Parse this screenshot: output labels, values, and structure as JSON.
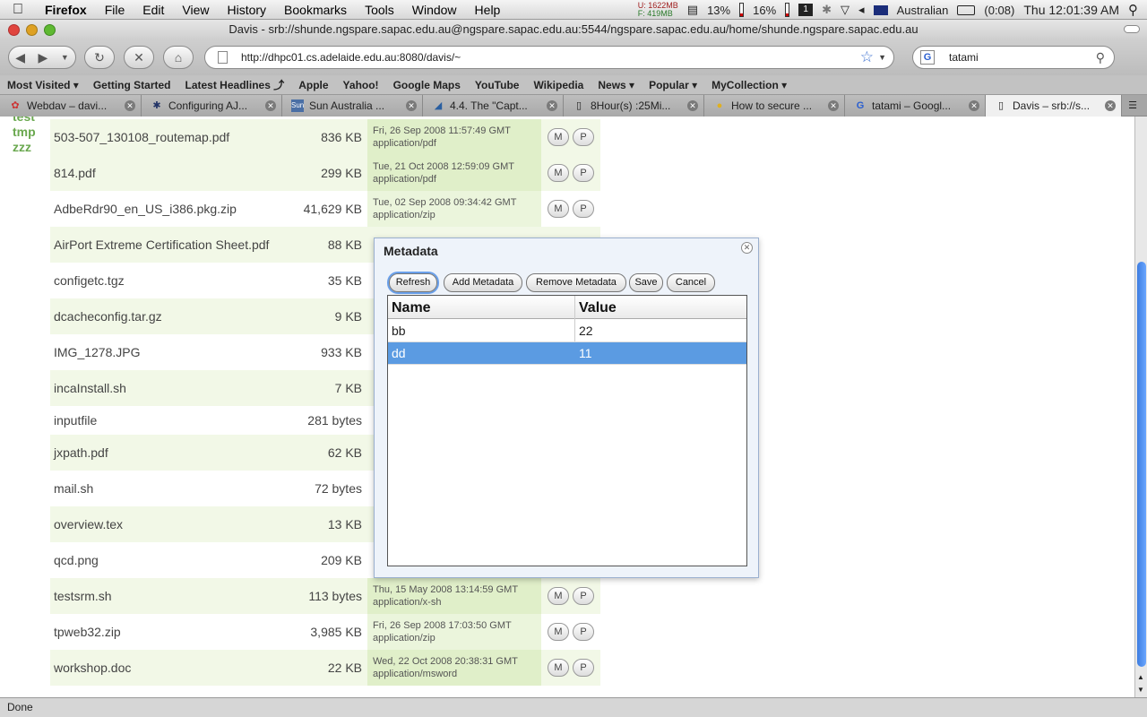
{
  "menubar": {
    "app": "Firefox",
    "items": [
      "File",
      "Edit",
      "View",
      "History",
      "Bookmarks",
      "Tools",
      "Window",
      "Help"
    ],
    "memory": {
      "u": "U: 1622MB",
      "f": "F:  419MB"
    },
    "cpu": "13%",
    "battery_pct": "16%",
    "keyboard": "Australian",
    "battery_time": "(0:08)",
    "clock": "Thu 12:01:39 AM"
  },
  "window": {
    "title": "Davis - srb://shunde.ngspare.sapac.edu.au@ngspare.sapac.edu.au:5544/ngspare.sapac.edu.au/home/shunde.ngspare.sapac.edu.au"
  },
  "nav": {
    "url": "http://dhpc01.cs.adelaide.edu.au:8080/davis/~",
    "search": "tatami"
  },
  "bookmarks": [
    "Most Visited ▾",
    "Getting Started",
    "Latest Headlines ⤴",
    "Apple",
    "Yahoo!",
    "Google Maps",
    "YouTube",
    "Wikipedia",
    "News ▾",
    "Popular ▾",
    "MyCollection ▾"
  ],
  "tabs": [
    {
      "label": "Webdav – davi...",
      "icon": "✿"
    },
    {
      "label": "Configuring AJ...",
      "icon": "✱"
    },
    {
      "label": "Sun Australia ...",
      "icon": "Sun"
    },
    {
      "label": "4.4. The \"Capt...",
      "icon": "◢"
    },
    {
      "label": "8Hour(s) :25Mi...",
      "icon": "▯"
    },
    {
      "label": "How to secure ...",
      "icon": "●"
    },
    {
      "label": "tatami – Googl...",
      "icon": "G"
    },
    {
      "label": "Davis – srb://s...",
      "icon": "▯"
    }
  ],
  "sidebar": [
    "test",
    "tmp",
    "zzz"
  ],
  "files": [
    {
      "name": "503-507_130108_routemap.pdf",
      "size": "836 KB",
      "date": "Fri, 26 Sep 2008 11:57:49 GMT",
      "type": "application/pdf"
    },
    {
      "name": "814.pdf",
      "size": "299 KB",
      "date": "Tue, 21 Oct 2008 12:59:09 GMT",
      "type": "application/pdf"
    },
    {
      "name": "AdbeRdr90_en_US_i386.pkg.zip",
      "size": "41,629 KB",
      "date": "Tue, 02 Sep 2008 09:34:42 GMT",
      "type": "application/zip"
    },
    {
      "name": "AirPort Extreme Certification Sheet.pdf",
      "size": "88 KB",
      "date": "",
      "type": ""
    },
    {
      "name": "configetc.tgz",
      "size": "35 KB",
      "date": "",
      "type": ""
    },
    {
      "name": "dcacheconfig.tar.gz",
      "size": "9 KB",
      "date": "",
      "type": ""
    },
    {
      "name": "IMG_1278.JPG",
      "size": "933 KB",
      "date": "",
      "type": ""
    },
    {
      "name": "incaInstall.sh",
      "size": "7 KB",
      "date": "",
      "type": ""
    },
    {
      "name": "inputfile",
      "size": "281 bytes",
      "date": "",
      "type": ""
    },
    {
      "name": "jxpath.pdf",
      "size": "62 KB",
      "date": "",
      "type": ""
    },
    {
      "name": "mail.sh",
      "size": "72 bytes",
      "date": "",
      "type": ""
    },
    {
      "name": "overview.tex",
      "size": "13 KB",
      "date": "",
      "type": ""
    },
    {
      "name": "qcd.png",
      "size": "209 KB",
      "date": "",
      "type": ""
    },
    {
      "name": "testsrm.sh",
      "size": "113 bytes",
      "date": "Thu, 15 May 2008 13:14:59 GMT",
      "type": "application/x-sh"
    },
    {
      "name": "tpweb32.zip",
      "size": "3,985 KB",
      "date": "Fri, 26 Sep 2008 17:03:50 GMT",
      "type": "application/zip"
    },
    {
      "name": "workshop.doc",
      "size": "22 KB",
      "date": "Wed, 22 Oct 2008 20:38:31 GMT",
      "type": "application/msword"
    }
  ],
  "row_buttons": {
    "m": "M",
    "p": "P"
  },
  "dialog": {
    "title": "Metadata",
    "buttons": {
      "refresh": "Refresh",
      "add": "Add Metadata",
      "remove": "Remove Metadata",
      "save": "Save",
      "cancel": "Cancel"
    },
    "columns": {
      "name": "Name",
      "value": "Value"
    },
    "rows": [
      {
        "name": "bb",
        "value": "22"
      },
      {
        "name": "dd",
        "value": "11"
      }
    ]
  },
  "status": "Done"
}
